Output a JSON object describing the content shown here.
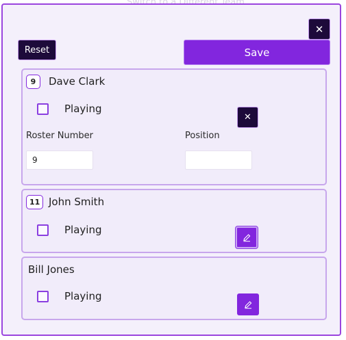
{
  "background": {
    "ghost_text": "Switch to a Different Team"
  },
  "modal": {
    "close_icon": "✕",
    "reset_label": "Reset",
    "save_label": "Save",
    "accent": "#8226de",
    "dark": "#1d0a3a"
  },
  "players": [
    {
      "number": "9",
      "name": "Dave Clark",
      "playing_label": "Playing",
      "playing": false,
      "expanded": true,
      "close_icon": "✕",
      "roster_label": "Roster Number",
      "roster_value": "9",
      "position_label": "Position",
      "position_value": ""
    },
    {
      "number": "11",
      "name": "John Smith",
      "playing_label": "Playing",
      "playing": false,
      "expanded": false,
      "edit_icon": "pencil-icon"
    },
    {
      "number": "",
      "name": "Bill Jones",
      "playing_label": "Playing",
      "playing": false,
      "expanded": false,
      "edit_icon": "pencil-icon"
    }
  ]
}
